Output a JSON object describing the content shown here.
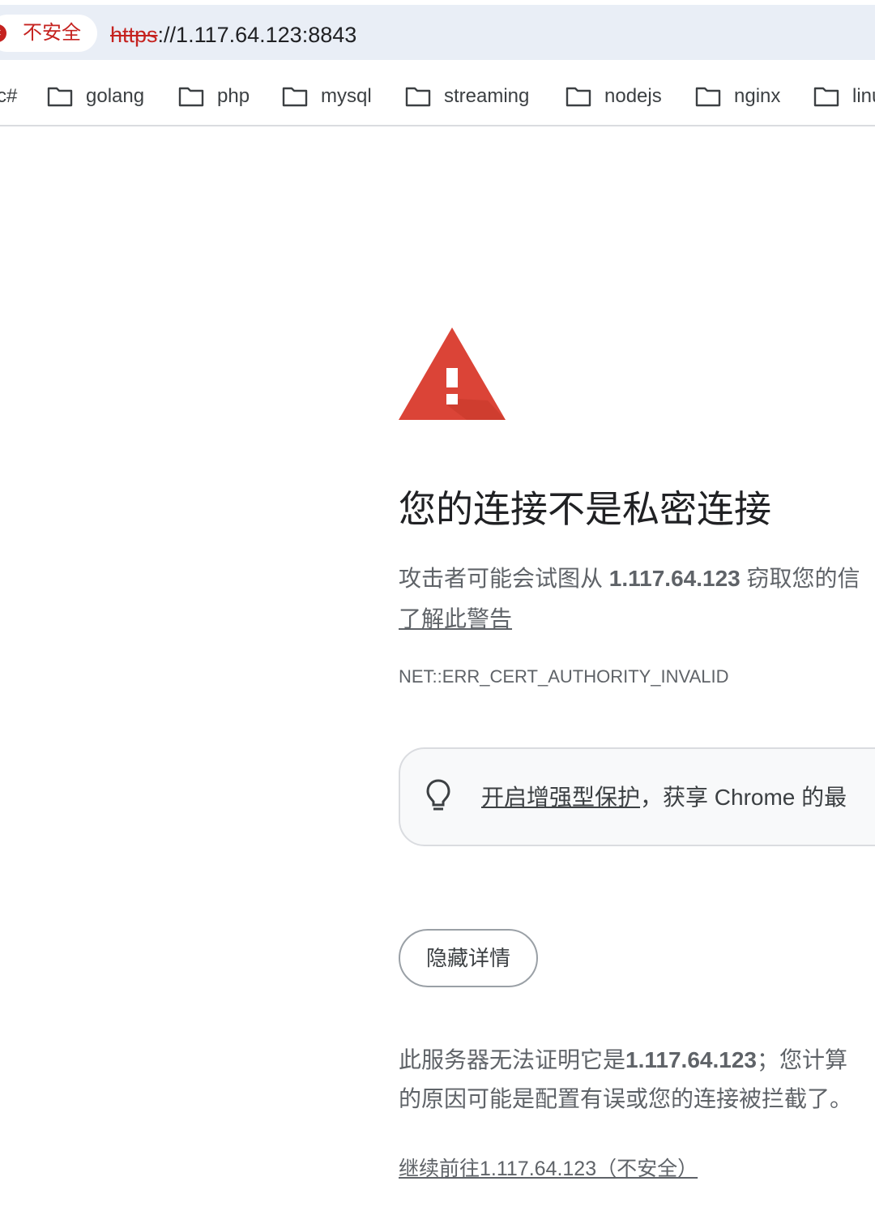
{
  "browser": {
    "security_chip_label": "不安全",
    "url_scheme": "https",
    "url_rest": "://1.117.64.123:8843"
  },
  "bookmarks": [
    {
      "label": "c#",
      "icon": "folder-icon"
    },
    {
      "label": "golang",
      "icon": "folder-icon"
    },
    {
      "label": "php",
      "icon": "folder-icon"
    },
    {
      "label": "mysql",
      "icon": "folder-icon"
    },
    {
      "label": "streaming",
      "icon": "folder-icon"
    },
    {
      "label": "nodejs",
      "icon": "folder-icon"
    },
    {
      "label": "nginx",
      "icon": "folder-icon"
    },
    {
      "label": "linu",
      "icon": "folder-icon"
    }
  ],
  "interstitial": {
    "icon": "warning-triangle-icon",
    "accent_color": "#db4437",
    "heading": "您的连接不是私密连接",
    "desc_prefix": "攻击者可能会试图从 ",
    "desc_host": "1.117.64.123",
    "desc_suffix": " 窃取您的信",
    "learn_more": "了解此警告",
    "error_code": "NET::ERR_CERT_AUTHORITY_INVALID",
    "enhanced_link": "开启增强型保护",
    "enhanced_rest": "，获享 Chrome 的最",
    "hide_details_button": "隐藏详情",
    "details_line1_prefix": "此服务器无法证明它是",
    "details_line1_host": "1.117.64.123",
    "details_line1_suffix": "；您计算",
    "details_line2": "的原因可能是配置有误或您的连接被拦截了。",
    "proceed_link": "继续前往1.117.64.123（不安全）"
  }
}
